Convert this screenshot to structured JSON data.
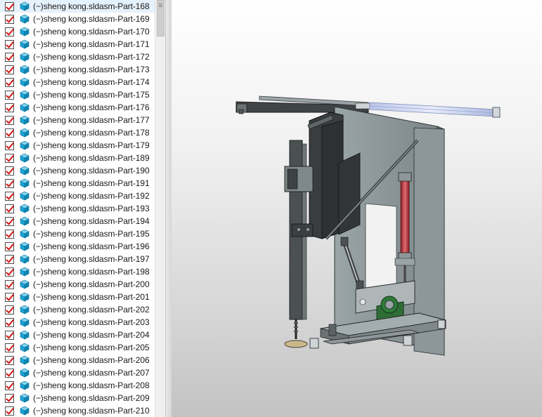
{
  "feature_tree": {
    "items": [
      {
        "label": "(−)sheng kong.sldasm-Part-168"
      },
      {
        "label": "(−)sheng kong.sldasm-Part-169"
      },
      {
        "label": "(−)sheng kong.sldasm-Part-170"
      },
      {
        "label": "(−)sheng kong.sldasm-Part-171"
      },
      {
        "label": "(−)sheng kong.sldasm-Part-172"
      },
      {
        "label": "(−)sheng kong.sldasm-Part-173"
      },
      {
        "label": "(−)sheng kong.sldasm-Part-174"
      },
      {
        "label": "(−)sheng kong.sldasm-Part-175"
      },
      {
        "label": "(−)sheng kong.sldasm-Part-176"
      },
      {
        "label": "(−)sheng kong.sldasm-Part-177"
      },
      {
        "label": "(−)sheng kong.sldasm-Part-178"
      },
      {
        "label": "(−)sheng kong.sldasm-Part-179"
      },
      {
        "label": "(−)sheng kong.sldasm-Part-189"
      },
      {
        "label": "(−)sheng kong.sldasm-Part-190"
      },
      {
        "label": "(−)sheng kong.sldasm-Part-191"
      },
      {
        "label": "(−)sheng kong.sldasm-Part-192"
      },
      {
        "label": "(−)sheng kong.sldasm-Part-193"
      },
      {
        "label": "(−)sheng kong.sldasm-Part-194"
      },
      {
        "label": "(−)sheng kong.sldasm-Part-195"
      },
      {
        "label": "(−)sheng kong.sldasm-Part-196"
      },
      {
        "label": "(−)sheng kong.sldasm-Part-197"
      },
      {
        "label": "(−)sheng kong.sldasm-Part-198"
      },
      {
        "label": "(−)sheng kong.sldasm-Part-200"
      },
      {
        "label": "(−)sheng kong.sldasm-Part-201"
      },
      {
        "label": "(−)sheng kong.sldasm-Part-202"
      },
      {
        "label": "(−)sheng kong.sldasm-Part-203"
      },
      {
        "label": "(−)sheng kong.sldasm-Part-204"
      },
      {
        "label": "(−)sheng kong.sldasm-Part-205"
      },
      {
        "label": "(−)sheng kong.sldasm-Part-206"
      },
      {
        "label": "(−)sheng kong.sldasm-Part-207"
      },
      {
        "label": "(−)sheng kong.sldasm-Part-208"
      },
      {
        "label": "(−)sheng kong.sldasm-Part-209"
      },
      {
        "label": "(−)sheng kong.sldasm-Part-210"
      }
    ],
    "checkbox_state": "checked",
    "item_icon": "part-cube-icon"
  },
  "colors": {
    "check_mark": "#d11818",
    "part_icon": "#1aa3d6",
    "viewport_top": "#ffffff",
    "viewport_bottom": "#c3c3c3",
    "frame_gray": "#8a9496",
    "cylinder_red": "#c0393e",
    "bearing_green": "#2e7a3a"
  }
}
